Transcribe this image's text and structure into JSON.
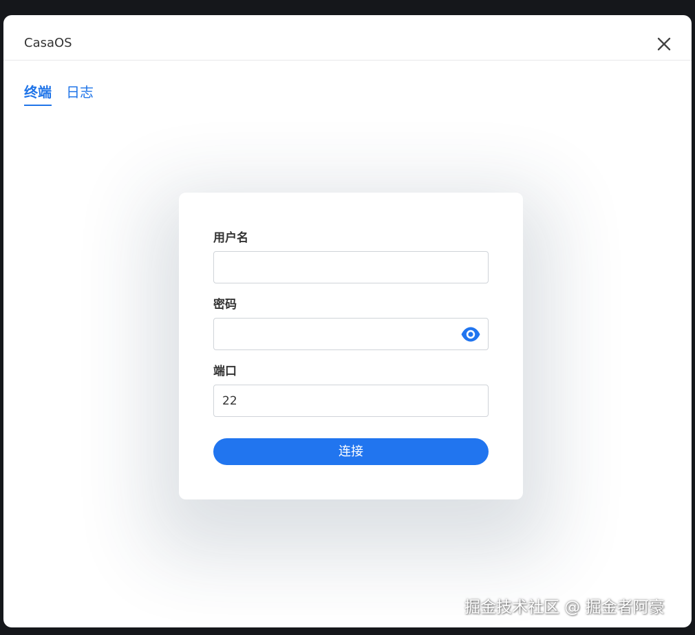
{
  "modal": {
    "title": "CasaOS",
    "close_icon": "close-icon"
  },
  "tabs": [
    {
      "label": "终端",
      "active": true
    },
    {
      "label": "日志",
      "active": false
    }
  ],
  "form": {
    "username": {
      "label": "用户名",
      "value": "",
      "placeholder": ""
    },
    "password": {
      "label": "密码",
      "value": "",
      "placeholder": "",
      "toggle_icon": "eye-icon"
    },
    "port": {
      "label": "端口",
      "value": "22"
    },
    "connect_label": "连接"
  },
  "watermark": "掘金技术社区 @ 掘金者阿豪",
  "colors": {
    "accent": "#1f74e8",
    "button": "#2175ef",
    "backdrop": "#15171b"
  }
}
